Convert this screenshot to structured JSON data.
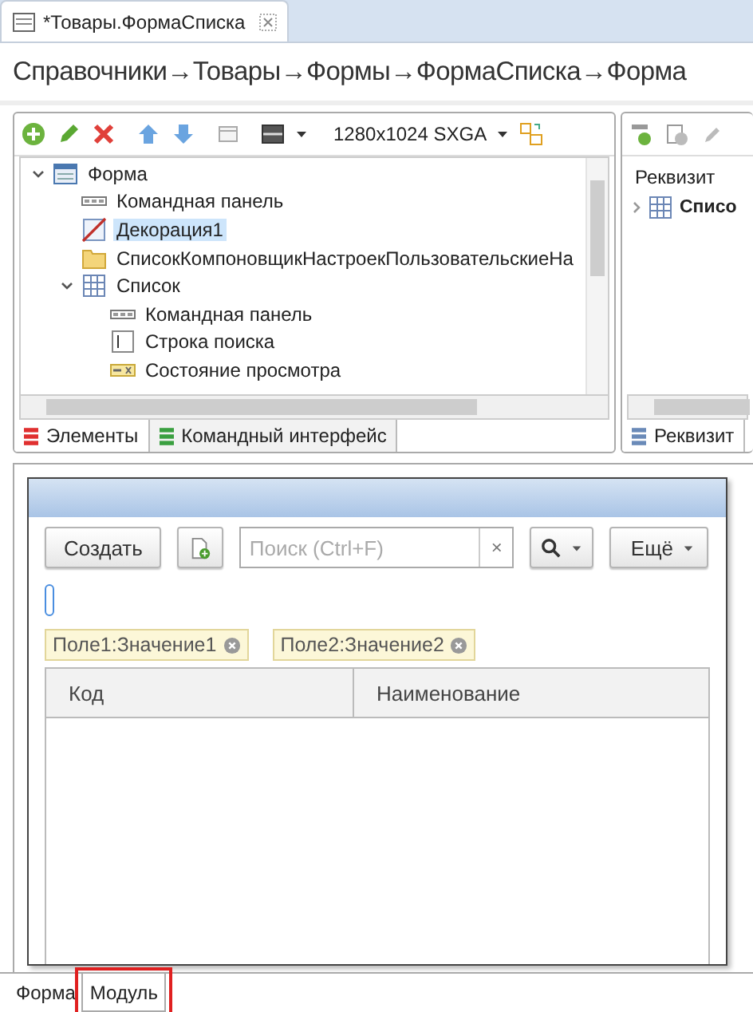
{
  "editor_tabs": [
    {
      "label": "*Товары.ФормаСписка",
      "selected": true
    }
  ],
  "breadcrumb": "Справочники→Товары→Формы→ФормаСписка→Форма",
  "elements_panel": {
    "resolution": "1280x1024 SXGA",
    "tree": [
      {
        "label": "Форма",
        "kind": "form",
        "selected": false,
        "expanded": true,
        "children": [
          {
            "label": "Командная панель",
            "kind": "command-bar",
            "selected": false
          },
          {
            "label": "Декорация1",
            "kind": "decoration",
            "selected": true
          },
          {
            "label": "СписокКомпоновщикНастроекПользовательскиеНа",
            "kind": "group",
            "selected": false
          },
          {
            "label": "Список",
            "kind": "table",
            "selected": false,
            "expanded": true,
            "children": [
              {
                "label": "Командная панель",
                "kind": "command-bar",
                "selected": false
              },
              {
                "label": "Строка поиска",
                "kind": "search-string",
                "selected": false
              },
              {
                "label": "Состояние просмотра",
                "kind": "view-state",
                "selected": false
              }
            ]
          }
        ]
      }
    ],
    "tabs": [
      {
        "label": "Элементы",
        "selected": true
      },
      {
        "label": "Командный интерфейс",
        "selected": false
      }
    ]
  },
  "attributes_panel": {
    "column": "Реквизит",
    "tree": [
      {
        "label": "Списо",
        "expanded": false
      }
    ],
    "tabs": [
      {
        "label": "Реквизит",
        "selected": true
      }
    ]
  },
  "preview": {
    "create_button": "Создать",
    "search_placeholder": "Поиск (Ctrl+F)",
    "clear": "×",
    "more_button": "Ещё",
    "filters": [
      "Поле1:Значение1",
      "Поле2:Значение2"
    ],
    "columns": [
      "Код",
      "Наименование"
    ]
  },
  "bottom_tabs": [
    {
      "label": "Форма",
      "selected": false,
      "highlighted": false
    },
    {
      "label": "Модуль",
      "selected": true,
      "highlighted": true
    }
  ]
}
